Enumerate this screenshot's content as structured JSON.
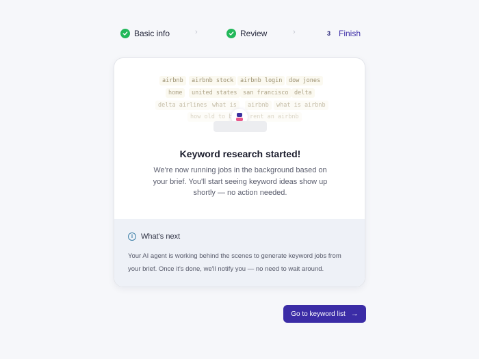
{
  "stepper": {
    "steps": [
      {
        "label": "Basic info",
        "state": "done"
      },
      {
        "label": "Review",
        "state": "done"
      },
      {
        "label": "Finish",
        "state": "current",
        "number": "3"
      }
    ],
    "separator": "›"
  },
  "keywords": {
    "row1": [
      "airbnb",
      "airbnb stock",
      "airbnb login",
      "dow jones"
    ],
    "row2": [
      "home",
      "united states",
      "san francisco",
      "delta"
    ],
    "row3": [
      "delta airlines",
      "what is",
      "airbnb",
      "what is airbnb"
    ],
    "row4": [
      "how old to be to rent an airbnb"
    ]
  },
  "card": {
    "title": "Keyword research started!",
    "description": "We're now running jobs in the background based on your brief. You'll start seeing keyword ideas show up shortly — no action needed.",
    "next_title": "What's next",
    "next_text": "Your AI agent is working behind the scenes to generate keyword jobs from your brief. Once it's done, we'll notify you — no need to wait around.",
    "info_icon": "i"
  },
  "actions": {
    "primary_label": "Go to keyword list",
    "primary_icon": "→"
  },
  "colors": {
    "accent": "#3b2ca6",
    "success": "#22b85a",
    "info": "#3c7fa7"
  }
}
